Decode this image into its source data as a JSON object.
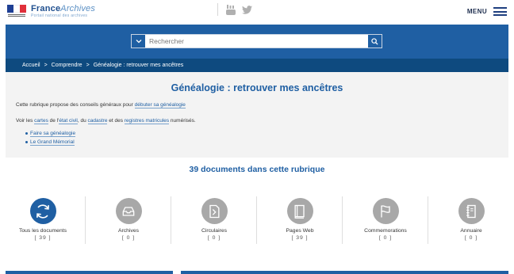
{
  "header": {
    "logo_brand_bold": "France",
    "logo_brand_italic": "Archives",
    "logo_tagline": "Portail national des archives",
    "menu_label": "MENU",
    "social_icons": [
      "youtube-icon",
      "twitter-icon"
    ],
    "flag_colors": [
      "#1f3f94",
      "#ffffff",
      "#e0303a"
    ]
  },
  "search": {
    "placeholder": "Rechercher"
  },
  "breadcrumb": [
    {
      "label": "Accueil"
    },
    {
      "label": "Comprendre"
    },
    {
      "label": "Généalogie : retrouver mes ancêtres"
    }
  ],
  "breadcrumb_separator": ">",
  "intro": {
    "title": "Généalogie : retrouver mes ancêtres",
    "p1_prefix": "Cette rubrique propose des conseils généraux pour ",
    "p1_link": "débuter sa généalogie",
    "p2_a": "Voir les ",
    "p2_link1": "cartes",
    "p2_b": " de l'",
    "p2_link2": "état civil",
    "p2_c": ", du ",
    "p2_link3": "cadastre",
    "p2_d": " et des ",
    "p2_link4": "registres matricules",
    "p2_e": " numérisés.",
    "links": [
      "Faire sa généalogie",
      "Le Grand Mémorial"
    ]
  },
  "documents_count_text": "39 documents dans cette rubrique",
  "categories": [
    {
      "label": "Tous les documents",
      "count": "[ 39 ]",
      "icon": "refresh-icon"
    },
    {
      "label": "Archives",
      "count": "[ 0 ]",
      "icon": "archive-box-icon"
    },
    {
      "label": "Circulaires",
      "count": "[ 0 ]",
      "icon": "document-arrow-icon"
    },
    {
      "label": "Pages Web",
      "count": "[ 39 ]",
      "icon": "book-icon"
    },
    {
      "label": "Commemorations",
      "count": "[ 0 ]",
      "icon": "flag-icon"
    },
    {
      "label": "Annuaire",
      "count": "[ 0 ]",
      "icon": "notebook-icon"
    }
  ],
  "colors": {
    "primary": "#1f5fa3",
    "breadcrumb_bg": "#0e4a7f",
    "inactive_icon": "#a8a8a8",
    "intro_bg": "#f3f3f3"
  }
}
